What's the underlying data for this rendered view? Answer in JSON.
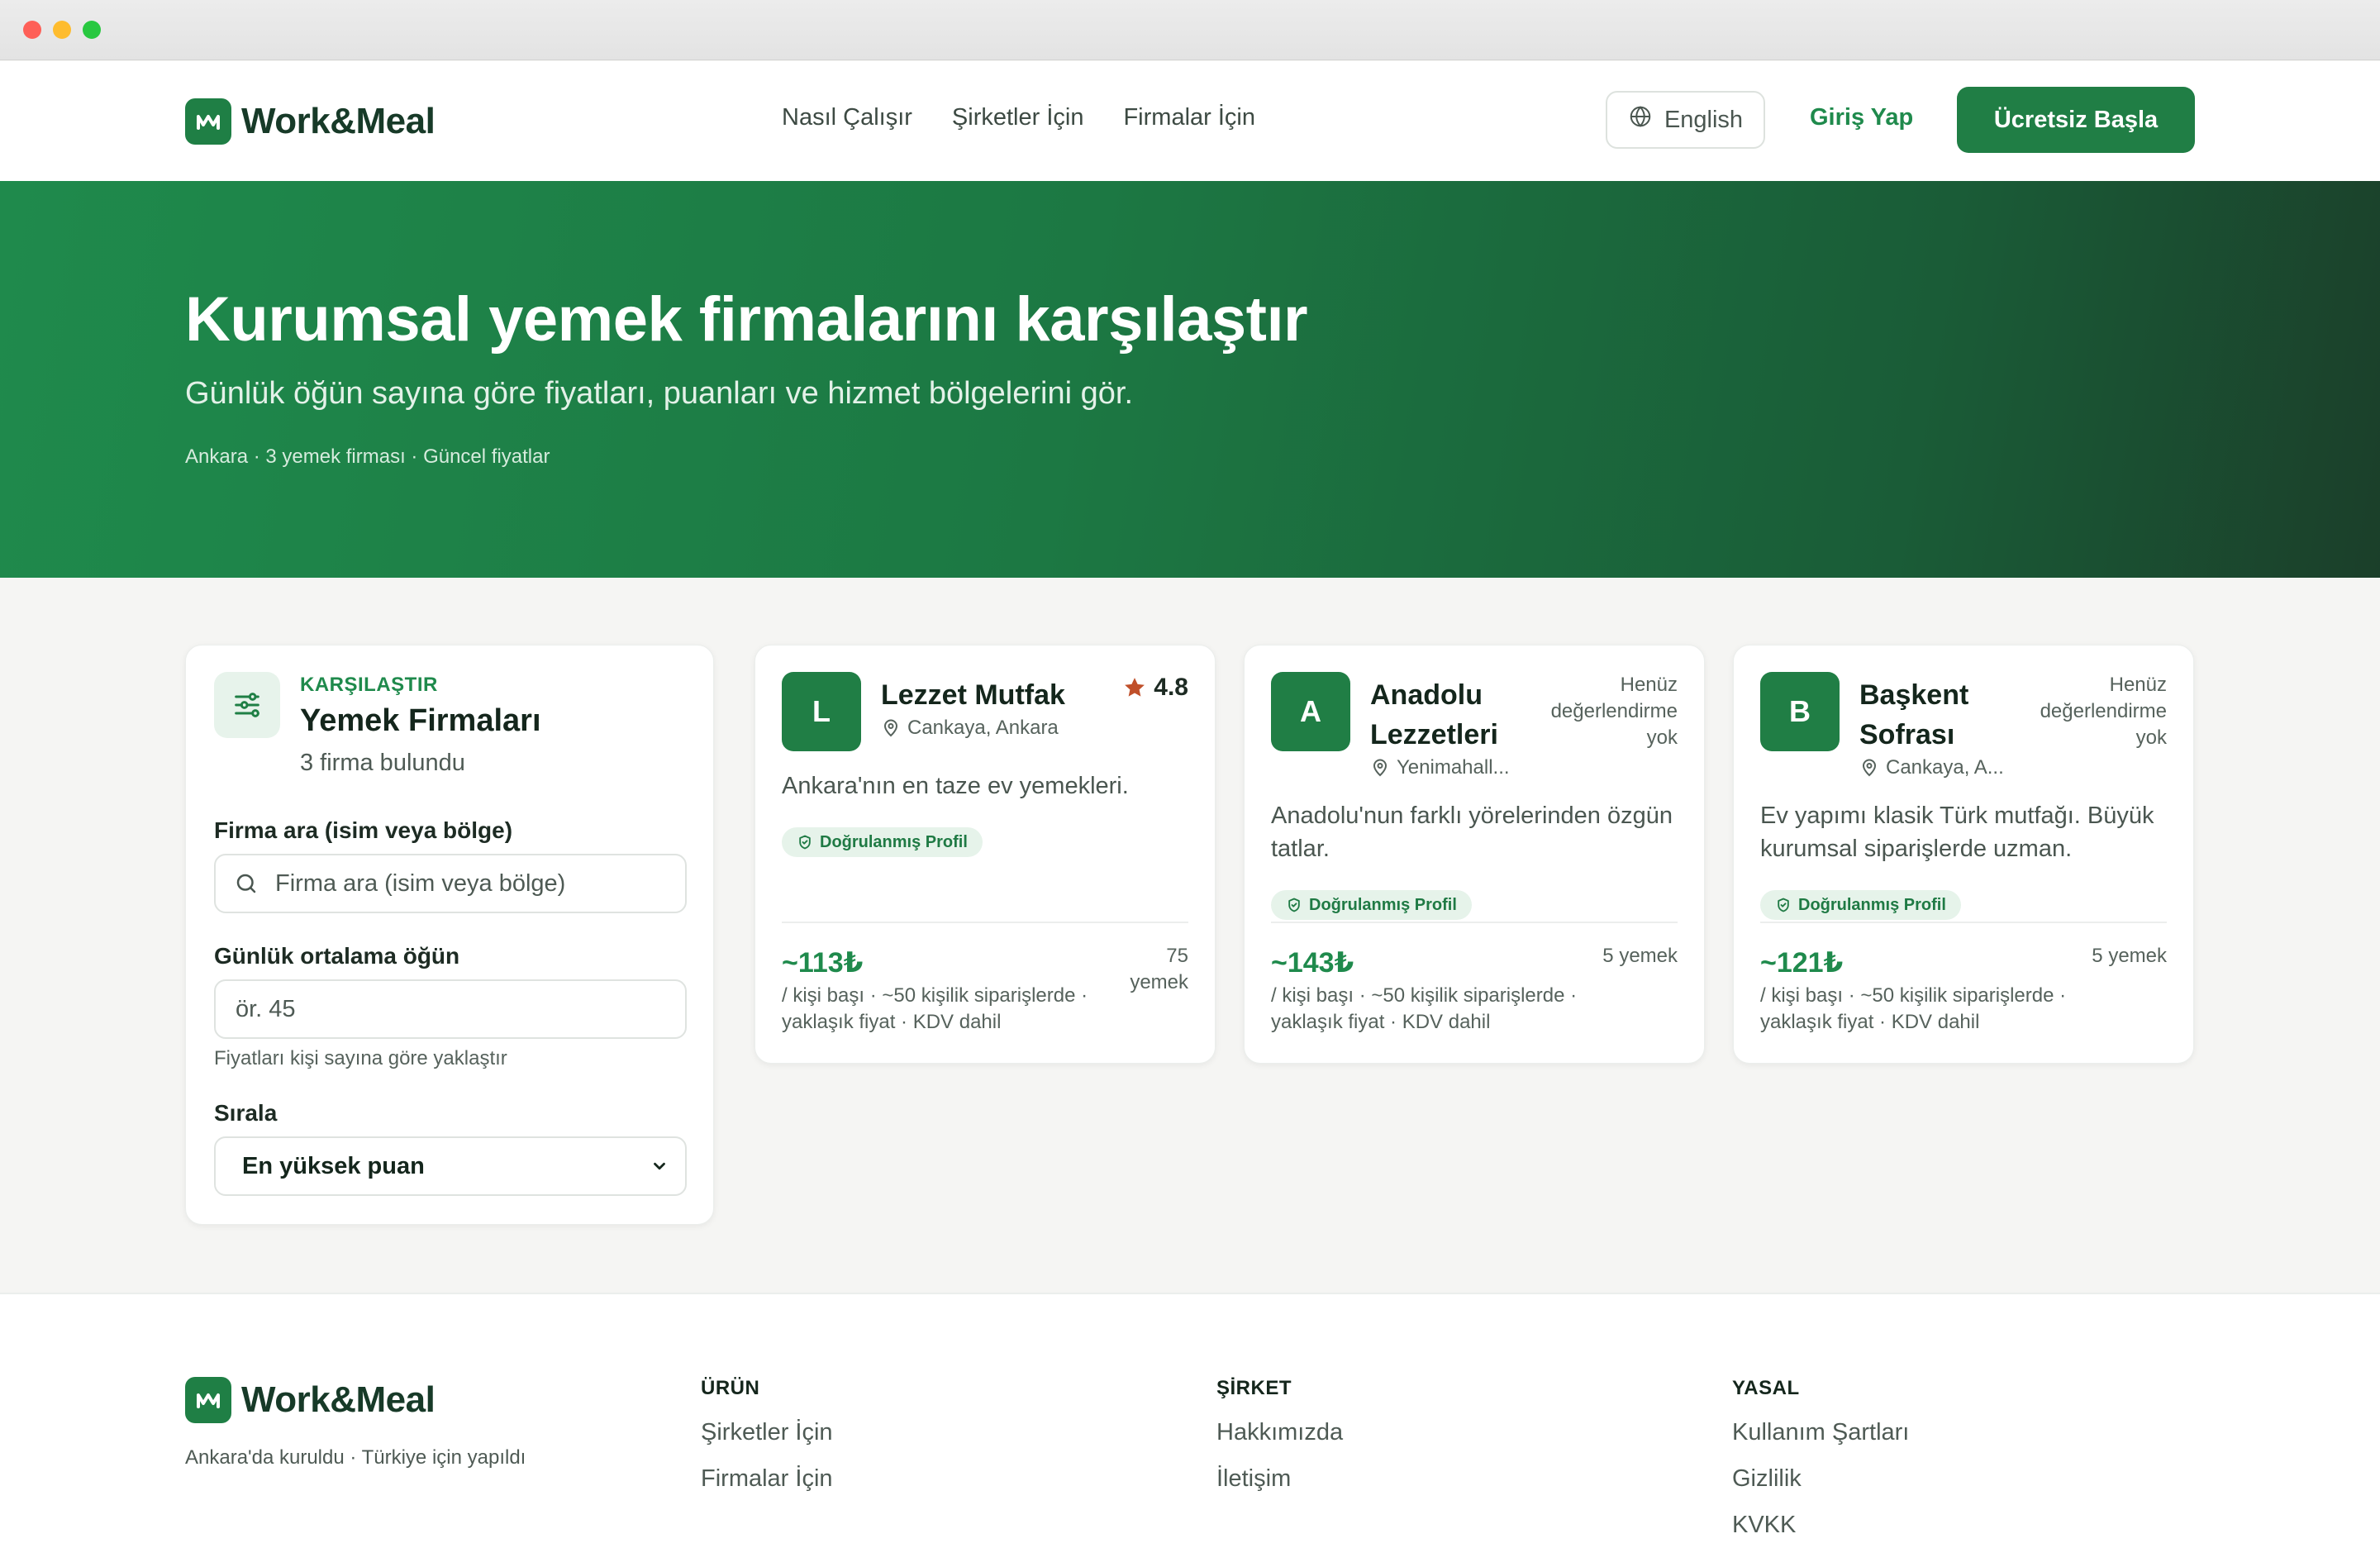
{
  "brand": {
    "name": "Work&Meal",
    "color": "#207e45"
  },
  "nav": {
    "links": [
      "Nasıl Çalışır",
      "Şirketler İçin",
      "Firmalar İçin"
    ],
    "language_label": "English",
    "login_label": "Giriş Yap",
    "cta_label": "Ücretsiz Başla"
  },
  "hero": {
    "title": "Kurumsal yemek firmalarını karşılaştır",
    "subtitle": "Günlük öğün sayına göre fiyatları, puanları ve hizmet bölgelerini gör.",
    "meta": "Ankara · 3 yemek firması · Güncel fiyatlar"
  },
  "filters": {
    "eyebrow": "KARŞILAŞTIR",
    "title": "Yemek Firmaları",
    "count": "3 firma bulundu",
    "search_label": "Firma ara (isim veya bölge)",
    "search_placeholder": "Firma ara (isim veya bölge)",
    "meals_label": "Günlük ortalama öğün",
    "meals_placeholder": "ör. 45",
    "meals_hint": "Fiyatları kişi sayına göre yaklaştır",
    "sort_label": "Sırala",
    "sort_value": "En yüksek puan"
  },
  "firms": [
    {
      "initial": "L",
      "name_line1": "Lezzet Mutfak",
      "name_line2": "",
      "location": "Cankaya, Ankara",
      "rating": "4.8",
      "unrated": "",
      "description": "Ankara'nın en taze ev yemekleri.",
      "badge": "Doğrulanmış Profil",
      "price": "~113₺",
      "price_note": "/ kişi başı · ~50 kişilik siparişlerde · yaklaşık fiyat · KDV dahil",
      "meals": "75 yemek"
    },
    {
      "initial": "A",
      "name_line1": "Anadolu",
      "name_line2": "Lezzetleri",
      "location": "Yenimahall...",
      "rating": "",
      "unrated": "Henüz değerlendirme yok",
      "description": "Anadolu'nun farklı yörelerinden özgün tatlar.",
      "badge": "Doğrulanmış Profil",
      "price": "~143₺",
      "price_note": "/ kişi başı · ~50 kişilik siparişlerde · yaklaşık fiyat · KDV dahil",
      "meals": "5 yemek"
    },
    {
      "initial": "B",
      "name_line1": "Başkent",
      "name_line2": "Sofrası",
      "location": "Cankaya, A...",
      "rating": "",
      "unrated": "Henüz değerlendirme yok",
      "description": "Ev yapımı klasik Türk mutfağı. Büyük kurumsal siparişlerde uzman.",
      "badge": "Doğrulanmış Profil",
      "price": "~121₺",
      "price_note": "/ kişi başı · ~50 kişilik siparişlerde · yaklaşık fiyat · KDV dahil",
      "meals": "5 yemek"
    }
  ],
  "footer": {
    "tagline": "Ankara'da kuruldu · Türkiye için yapıldı",
    "columns": [
      {
        "heading": "ÜRÜN",
        "links": [
          "Şirketler İçin",
          "Firmalar İçin"
        ]
      },
      {
        "heading": "ŞİRKET",
        "links": [
          "Hakkımızda",
          "İletişim"
        ]
      },
      {
        "heading": "YASAL",
        "links": [
          "Kullanım Şartları",
          "Gizlilik",
          "KVKK"
        ]
      }
    ]
  },
  "icons": {
    "logo": "logo-icon",
    "globe": "globe-icon",
    "filter": "sliders-icon",
    "search": "search-icon",
    "location": "map-pin-icon",
    "star": "star-icon",
    "verified": "shield-check-icon",
    "chevron": "chevron-down-icon"
  },
  "colors": {
    "accent": "#1f8a4c",
    "star": "#c0502a",
    "badge_bg": "#e6f3ea"
  }
}
